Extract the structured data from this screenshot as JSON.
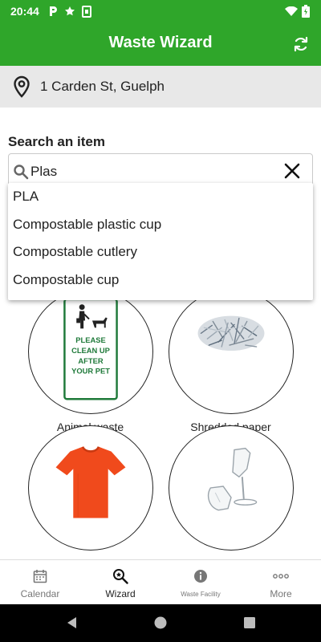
{
  "status_bar": {
    "time": "20:44"
  },
  "app_bar": {
    "title": "Waste Wizard"
  },
  "location": {
    "address": "1 Carden St, Guelph"
  },
  "search": {
    "label": "Search an item",
    "value": "Plas",
    "suggestions": [
      "PLA",
      "Compostable plastic cup",
      "Compostable cutlery",
      "Compostable cup"
    ]
  },
  "grid": {
    "items": [
      {
        "label": "Animal waste",
        "sign_text": [
          "PLEASE",
          "CLEAN UP",
          "AFTER",
          "YOUR PET"
        ]
      },
      {
        "label": "Shredded paper"
      },
      {
        "label": ""
      },
      {
        "label": ""
      }
    ]
  },
  "bottom_nav": {
    "items": [
      {
        "label": "Calendar",
        "icon": "calendar-icon"
      },
      {
        "label": "Wizard",
        "icon": "wizard-icon",
        "active": true
      },
      {
        "label": "Waste Facility",
        "icon": "info-icon"
      },
      {
        "label": "More",
        "icon": "more-icon"
      }
    ]
  },
  "colors": {
    "primary": "#2fa62a",
    "location_bg": "#e8e8e8",
    "shirt": "#f04a1c"
  }
}
